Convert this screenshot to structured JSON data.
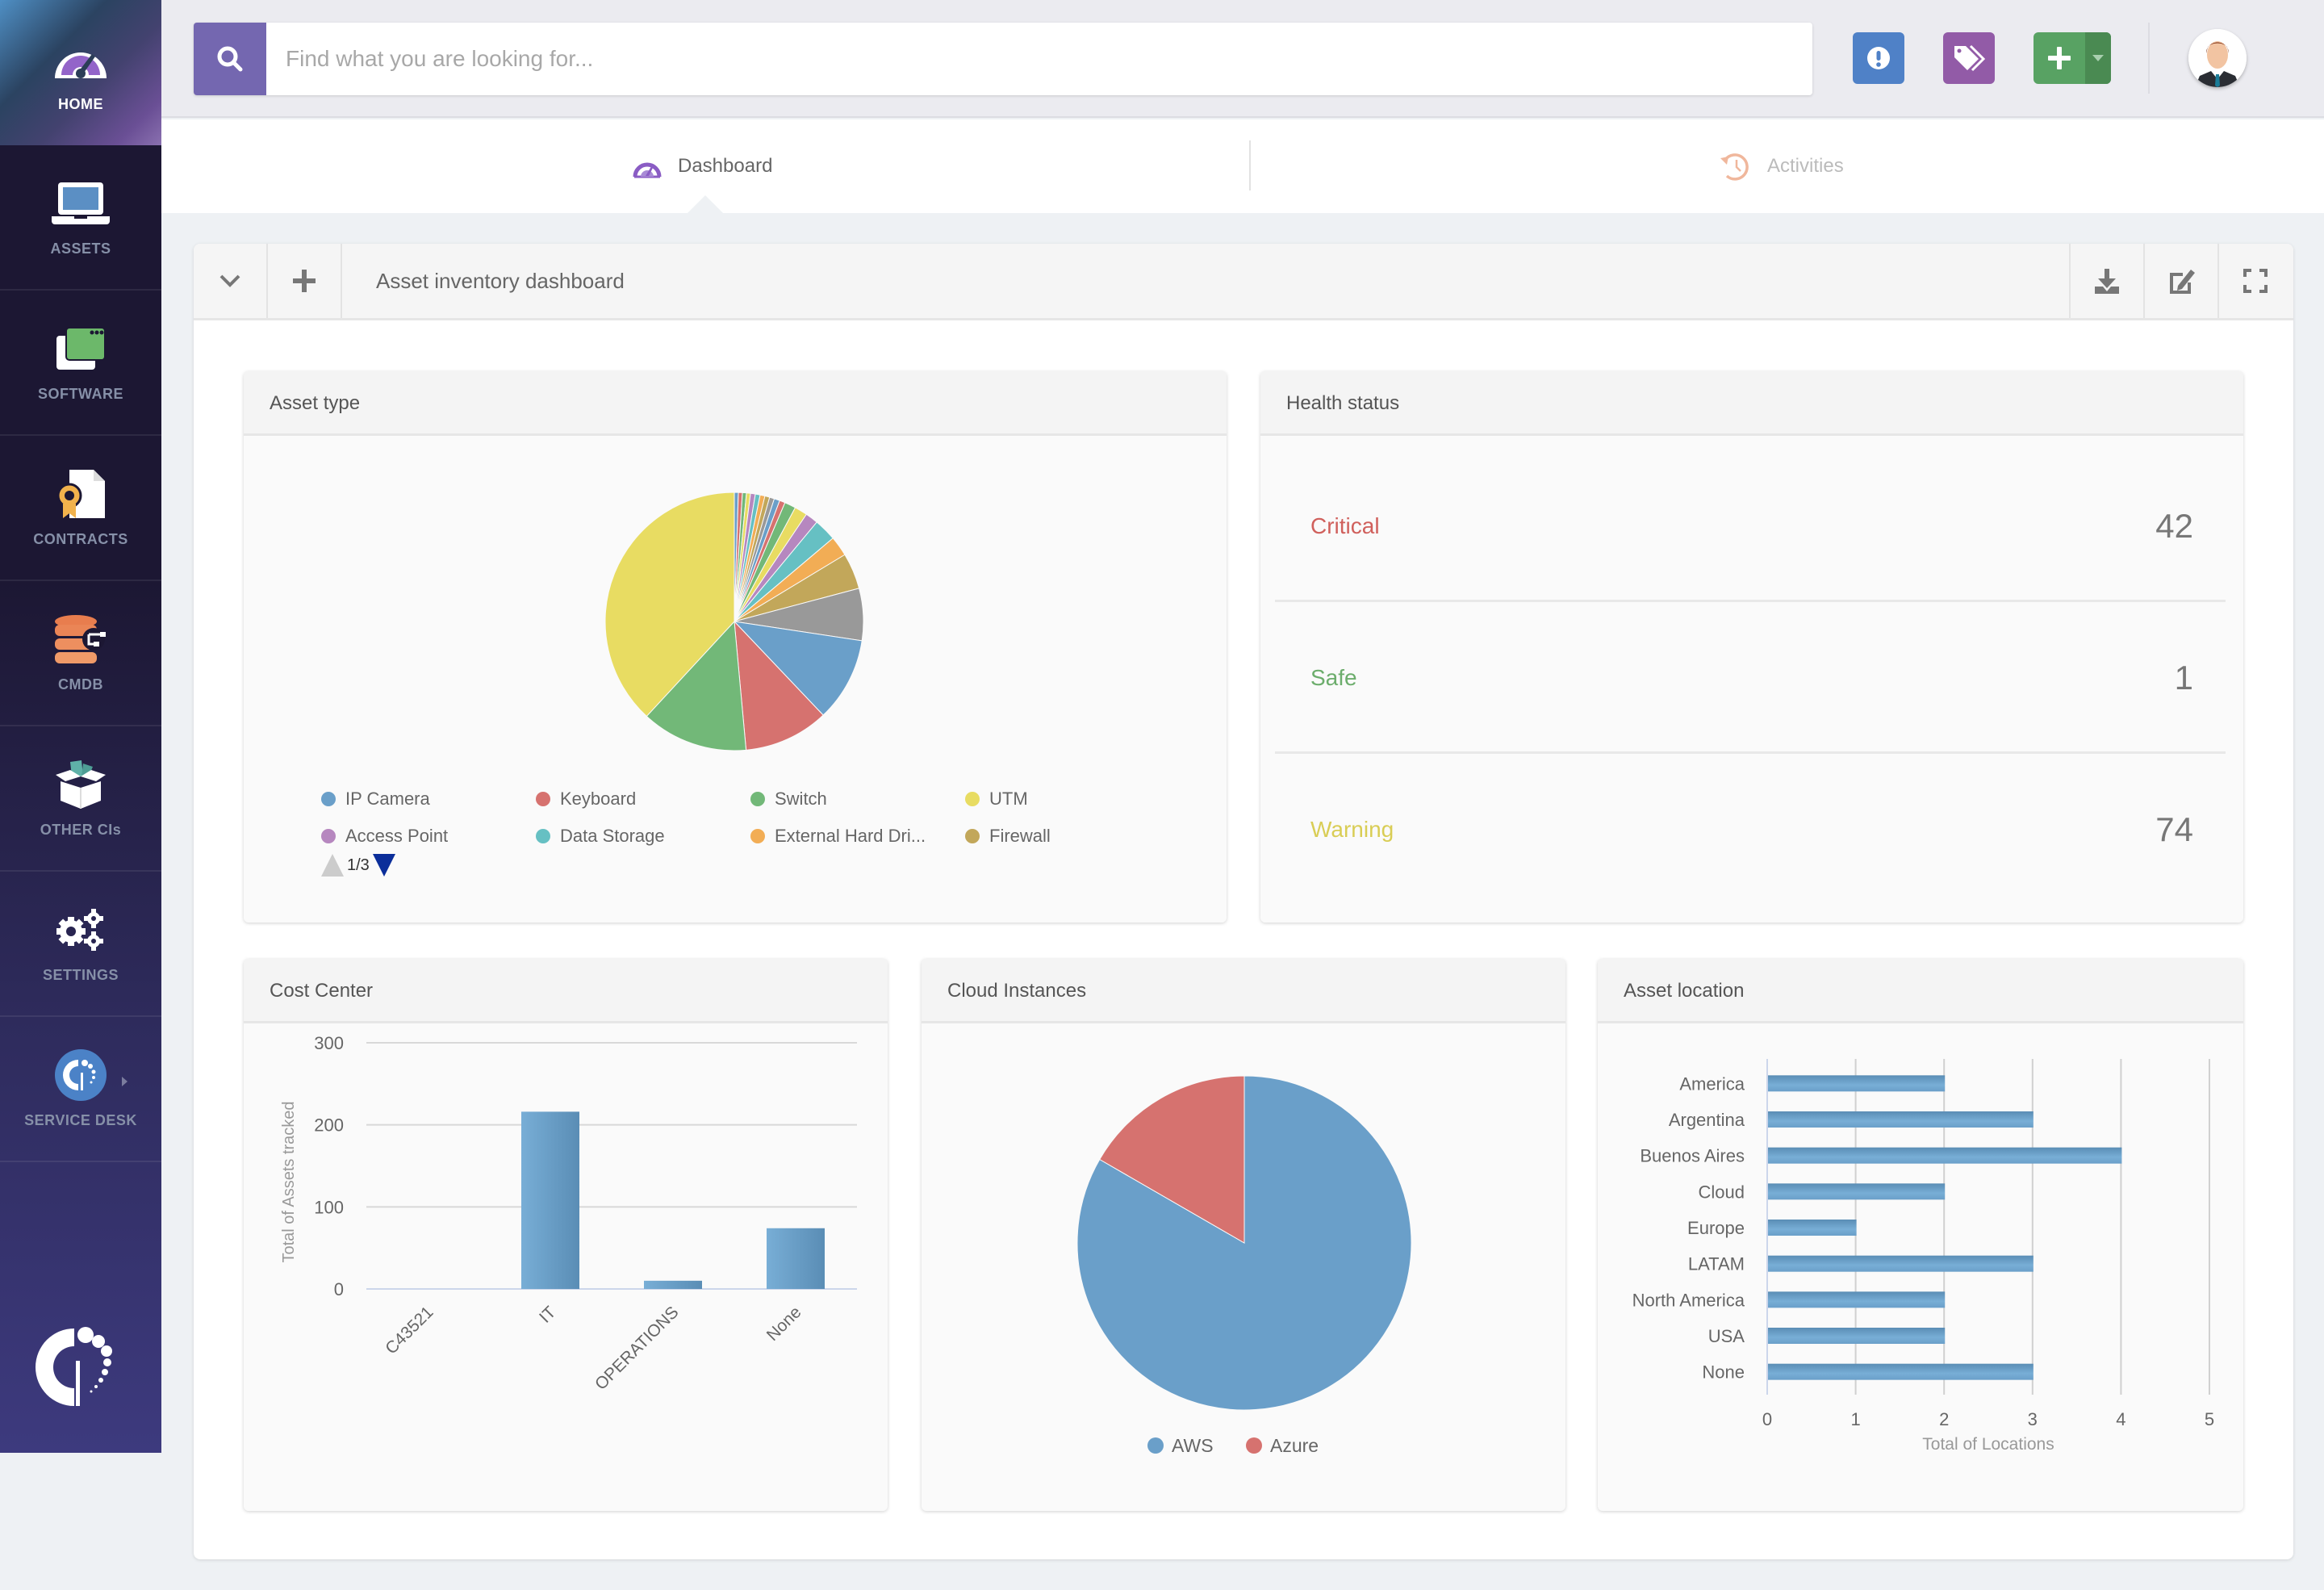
{
  "sidebar": {
    "items": [
      {
        "label": "HOME",
        "icon": "gauge-icon",
        "active": true
      },
      {
        "label": "ASSETS",
        "icon": "laptop-icon"
      },
      {
        "label": "SOFTWARE",
        "icon": "software-window-icon"
      },
      {
        "label": "CONTRACTS",
        "icon": "contract-certificate-icon"
      },
      {
        "label": "CMDB",
        "icon": "database-network-icon"
      },
      {
        "label": "OTHER CIs",
        "icon": "open-box-icon"
      },
      {
        "label": "SETTINGS",
        "icon": "gears-icon"
      },
      {
        "label": "SERVICE DESK",
        "icon": "service-desk-logo-icon"
      }
    ]
  },
  "topbar": {
    "search_placeholder": "Find what you are looking for...",
    "colors": {
      "search": "#7467b0",
      "alert": "#4f81c7",
      "tag": "#925ba7",
      "add": "#58a263"
    }
  },
  "tabs": [
    {
      "label": "Dashboard",
      "icon": "gauge-icon",
      "active": true
    },
    {
      "label": "Activities",
      "icon": "history-icon",
      "active": false
    }
  ],
  "dashboard": {
    "title": "Asset inventory dashboard"
  },
  "panels": {
    "asset_type": {
      "title": "Asset type",
      "legend": [
        {
          "label": "IP Camera",
          "color": "#6a9fc9"
        },
        {
          "label": "Keyboard",
          "color": "#d6726f"
        },
        {
          "label": "Switch",
          "color": "#72b878"
        },
        {
          "label": "UTM",
          "color": "#e8dc62"
        },
        {
          "label": "Access Point",
          "color": "#b687bf"
        },
        {
          "label": "Data Storage",
          "color": "#66c0c3"
        },
        {
          "label": "External Hard Dri...",
          "color": "#f2ad55"
        },
        {
          "label": "Firewall",
          "color": "#c2a75a"
        }
      ],
      "pager": "1/3"
    },
    "health": {
      "title": "Health status",
      "rows": [
        {
          "label": "Critical",
          "value": "42",
          "color": "#d0605c"
        },
        {
          "label": "Safe",
          "value": "1",
          "color": "#6cad6c"
        },
        {
          "label": "Warning",
          "value": "74",
          "color": "#d9cd55"
        }
      ]
    },
    "cost_center": {
      "title": "Cost Center"
    },
    "cloud": {
      "title": "Cloud Instances"
    },
    "location": {
      "title": "Asset location"
    }
  },
  "chart_data": [
    {
      "type": "pie",
      "title": "Asset type",
      "legend_position": "bottom",
      "note": "values in percent of total, listed clockwise from top",
      "slices": [
        {
          "name": null,
          "color": "#6a9fc9",
          "value": 0.5
        },
        {
          "name": null,
          "color": "#d6726f",
          "value": 0.5
        },
        {
          "name": null,
          "color": "#72b878",
          "value": 0.5
        },
        {
          "name": null,
          "color": "#e8dc62",
          "value": 0.5
        },
        {
          "name": null,
          "color": "#b687bf",
          "value": 0.6
        },
        {
          "name": null,
          "color": "#66c0c3",
          "value": 0.6
        },
        {
          "name": null,
          "color": "#f2ad55",
          "value": 0.6
        },
        {
          "name": null,
          "color": "#c2a75a",
          "value": 0.6
        },
        {
          "name": null,
          "color": "#999999",
          "value": 0.6
        },
        {
          "name": null,
          "color": "#6a9fc9",
          "value": 0.7
        },
        {
          "name": null,
          "color": "#d6726f",
          "value": 0.7
        },
        {
          "name": null,
          "color": "#72b878",
          "value": 1.4
        },
        {
          "name": null,
          "color": "#e8dc62",
          "value": 1.6
        },
        {
          "name": null,
          "color": "#b687bf",
          "value": 1.6
        },
        {
          "name": null,
          "color": "#66c0c3",
          "value": 2.8
        },
        {
          "name": null,
          "color": "#f2ad55",
          "value": 2.5
        },
        {
          "name": null,
          "color": "#c2a75a",
          "value": 4.5
        },
        {
          "name": null,
          "color": "#999999",
          "value": 6.5
        },
        {
          "name": "IP Camera",
          "color": "#6a9fc9",
          "value": 10.5
        },
        {
          "name": "Keyboard",
          "color": "#d6726f",
          "value": 10.6
        },
        {
          "name": "Switch",
          "color": "#72b878",
          "value": 13.3
        },
        {
          "name": "UTM",
          "color": "#e8dc62",
          "value": 38.0
        }
      ]
    },
    {
      "type": "bar",
      "title": "Cost Center",
      "categories": [
        "C43521",
        "IT",
        "OPERATIONS",
        "None"
      ],
      "values": [
        0,
        216,
        10,
        74
      ],
      "ylabel": "Total of Assets tracked",
      "xlabel": "",
      "ylim": [
        0,
        300
      ],
      "yticks": [
        0,
        100,
        200,
        300
      ],
      "grid": true,
      "color": "#6a9fc9"
    },
    {
      "type": "pie",
      "title": "Cloud Instances",
      "legend_position": "bottom",
      "slices": [
        {
          "name": "AWS",
          "value": 5,
          "color": "#6a9fc9"
        },
        {
          "name": "Azure",
          "value": 1,
          "color": "#d6726f"
        }
      ]
    },
    {
      "type": "bar",
      "orientation": "horizontal",
      "title": "Asset location",
      "categories": [
        "America",
        "Argentina",
        "Buenos Aires",
        "Cloud",
        "Europe",
        "LATAM",
        "North America",
        "USA",
        "None"
      ],
      "values": [
        2,
        3,
        4,
        2,
        1,
        3,
        2,
        2,
        3
      ],
      "xlabel": "Total of Locations",
      "ylabel": "",
      "xlim": [
        0,
        5
      ],
      "xticks": [
        0,
        1,
        2,
        3,
        4,
        5
      ],
      "grid": true,
      "color": "#6a9fc9"
    }
  ]
}
